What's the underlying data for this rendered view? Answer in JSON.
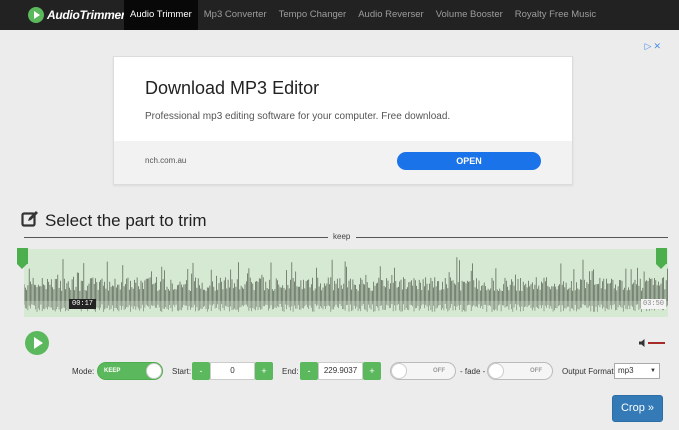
{
  "navbar": {
    "brand": "AudioTrimmer",
    "items": [
      {
        "label": "Audio Trimmer",
        "active": true
      },
      {
        "label": "Mp3 Converter",
        "active": false
      },
      {
        "label": "Tempo Changer",
        "active": false
      },
      {
        "label": "Audio Reverser",
        "active": false
      },
      {
        "label": "Volume Booster",
        "active": false
      },
      {
        "label": "Royalty Free Music",
        "active": false
      }
    ]
  },
  "ad": {
    "close_label": "▷✕",
    "title": "Download MP3 Editor",
    "description": "Professional mp3 editing software for your computer. Free download.",
    "domain": "nch.com.au",
    "cta": "OPEN"
  },
  "trimmer": {
    "title": "Select the part to trim",
    "range_label": "keep",
    "start_time_display": "00:17",
    "end_time_display": "03:50"
  },
  "controls": {
    "mode_label": "Mode:",
    "mode_value": "KEEP",
    "start_label": "Start:",
    "start_value": "0",
    "end_label": "End:",
    "end_value": "229.9037",
    "fade_in_value": "OFF",
    "fade_label": "- fade -",
    "fade_out_value": "OFF",
    "output_format_label": "Output Format:",
    "output_format_value": "mp3",
    "minus": "-",
    "plus": "+",
    "crop_label": "Crop »"
  },
  "colors": {
    "accent_green": "#5cb85c",
    "primary_blue": "#337ab7",
    "navbar_bg": "#222222"
  }
}
